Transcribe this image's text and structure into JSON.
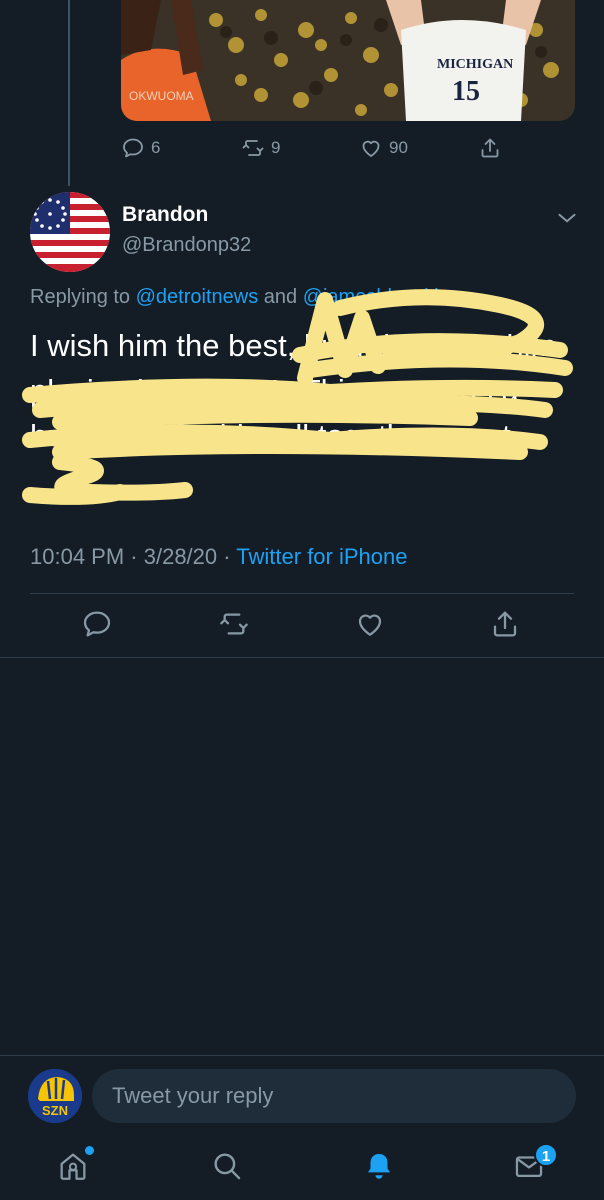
{
  "parent_tweet": {
    "jersey_text": "MICHIGAN",
    "jersey_number": "15",
    "back_name": "OKWUOMA",
    "actions": {
      "reply_count": "6",
      "retweet_count": "9",
      "like_count": "90"
    }
  },
  "tweet": {
    "author_name": "Brandon",
    "author_handle": "@Brandonp32",
    "replying_prefix": "Replying to ",
    "mention_1": "@detroitnews",
    "replying_joiner": " and ",
    "mention_2": "@jamesbhawkins",
    "text": "I wish him the best, but I don't see him playing in the NBA. This year was a huge step for him all together great",
    "time": "10:04 PM",
    "date": "3/28/20",
    "separator": " · ",
    "client": "Twitter for iPhone"
  },
  "composer": {
    "avatar_text": "SZN",
    "placeholder": "Tweet your reply"
  },
  "bottom_nav": {
    "messages_badge": "1"
  },
  "colors": {
    "background": "#141d26",
    "accent": "#1da1f2",
    "secondary_text": "#8899a6",
    "scribble": "#f8e58b"
  }
}
